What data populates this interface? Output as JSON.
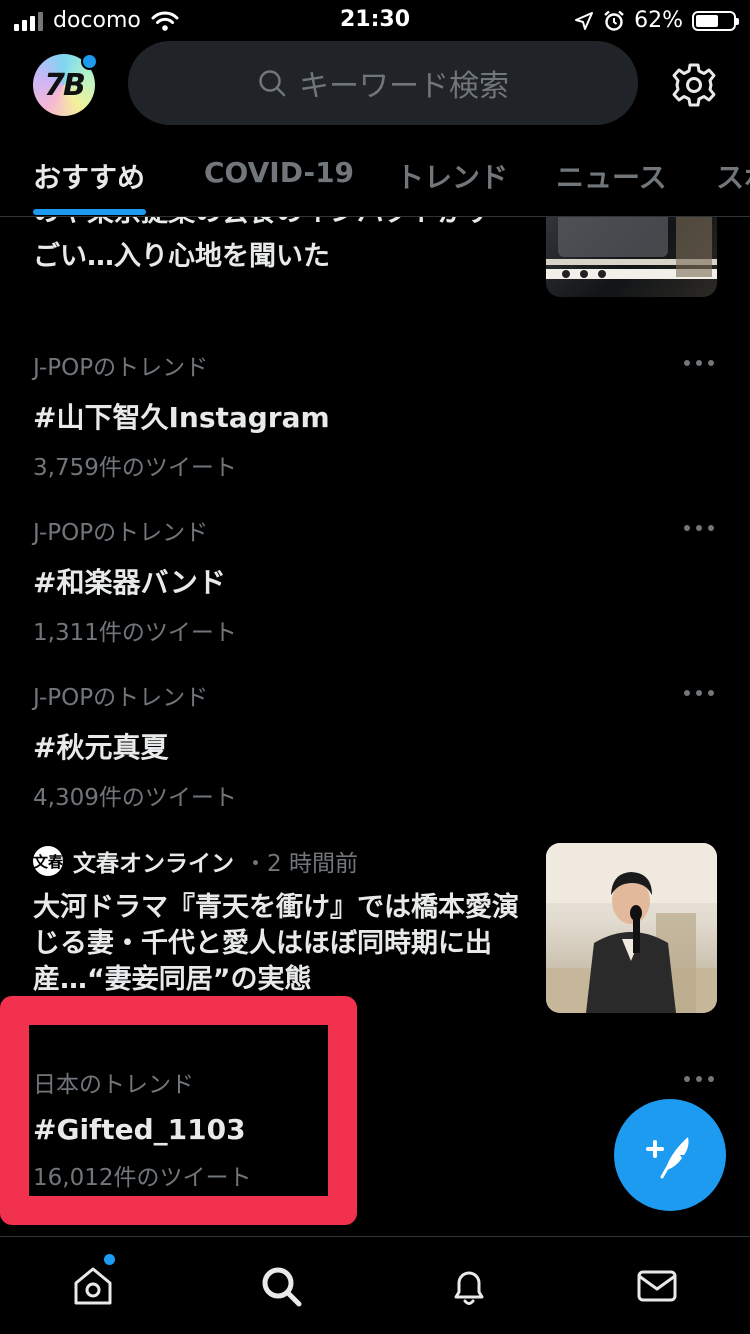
{
  "status_bar": {
    "carrier": "docomo",
    "time": "21:30",
    "battery_percent": "62%",
    "battery_level": 0.62
  },
  "header": {
    "avatar_label": "7B",
    "avatar_has_notification": true,
    "search_placeholder": "キーワード検索",
    "settings_icon": "gear-icon"
  },
  "tabs": [
    {
      "label": "おすすめ",
      "active": true
    },
    {
      "label": "COVID-19",
      "active": false
    },
    {
      "label": "トレンド",
      "active": false
    },
    {
      "label": "ニュース",
      "active": false
    },
    {
      "label": "スポ",
      "active": false
    }
  ],
  "feed": {
    "partial_news": {
      "headline": "のや東京提案の会食のインパクトがすごい…入り心地を聞いた"
    },
    "trends": [
      {
        "context": "J-POPのトレンド",
        "name": "#山下智久Instagram",
        "count": "3,759件のツイート"
      },
      {
        "context": "J-POPのトレンド",
        "name": "#和楽器バンド",
        "count": "1,311件のツイート"
      },
      {
        "context": "J-POPのトレンド",
        "name": "#秋元真夏",
        "count": "4,309件のツイート"
      }
    ],
    "news": {
      "source_logo": "文春",
      "source": "文春オンライン",
      "time": "・2 時間前",
      "headline": "大河ドラマ『青天を衝け』では橋本愛演じる妻・千代と愛人はほぼ同時期に出産…“妻妾同居”の実態"
    },
    "highlighted_trend": {
      "context": "日本のトレンド",
      "name": "#Gifted_1103",
      "count": "16,012件のツイート"
    }
  },
  "fab": {
    "icon": "compose-tweet-icon"
  },
  "bottom_nav": [
    {
      "name": "home",
      "icon": "home-icon",
      "has_notification": true
    },
    {
      "name": "search",
      "icon": "search-icon",
      "active": true
    },
    {
      "name": "notifications",
      "icon": "bell-icon"
    },
    {
      "name": "messages",
      "icon": "mail-icon"
    }
  ],
  "colors": {
    "accent": "#1d9bf0",
    "highlight_box": "#f1314e",
    "background": "#000000",
    "secondary_text": "#71767b"
  }
}
